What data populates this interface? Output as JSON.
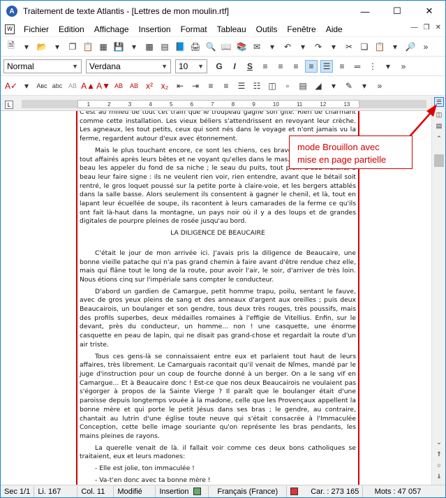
{
  "window": {
    "title": "Traitement de texte Atlantis - [Lettres de mon moulin.rtf]",
    "app_icon": "atlantis-logo-icon",
    "controls": [
      "minimize-icon",
      "maximize-icon",
      "close-icon"
    ]
  },
  "menu": {
    "items": [
      "Fichier",
      "Edition",
      "Affichage",
      "Insertion",
      "Format",
      "Tableau",
      "Outils",
      "Fenêtre",
      "Aide"
    ]
  },
  "format_toolbar": {
    "style_value": "Normal",
    "font_value": "Verdana",
    "size_value": "10"
  },
  "ruler": {
    "tab_selector": "L",
    "ticks": [
      "1",
      "2",
      "3",
      "4",
      "5",
      "6",
      "7",
      "8",
      "9",
      "10",
      "11",
      "12",
      "13"
    ]
  },
  "document": {
    "paragraphs": [
      "C'est au milieu de tout cet train que le troupeau gagne son gîte. Rien de charmant comme cette installation. Les vieux béliers s'attendrissent en revoyant leur crèche. Les agneaux, les tout petits, ceux qui sont nés dans le voyage et n'ont jamais vu la ferme, regardent autour d'eux avec étonnement.",
      "Mais le plus touchant encore, ce sont les chiens, ces braves chiens de berger, tout affairés après leurs bêtes et ne voyant qu'elles dans le mas. Le chien de garde a beau les appeler du fond de sa niche ; le seau du puits, tout plein d'eau fraîche, a beau leur faire signe : ils ne veulent rien voir, rien entendre, avant que le bétail soit rentré, le gros loquet poussé sur la petite porte à claire-voie, et les bergers attablés dans la salle basse. Alors seulement ils consentent à gagner le chenil, et là, tout en lapant leur écuellée de soupe, ils racontent à leurs camarades de la ferme ce qu'ils ont fait là-haut dans la montagne, un pays noir où il y a des loups et de grandes digitales de pourpre pleines de rosée jusqu'au bord."
    ],
    "heading": "LA DILIGENCE DE BEAUCAIRE",
    "paragraphs2": [
      "C'était le jour de mon arrivée ici. J'avais pris la diligence de Beaucaire, une bonne vieille patache qui n'a pas grand chemin à faire avant d'être rendue chez elle, mais qui flâne tout le long de la route, pour avoir l'air, le soir, d'arriver de très loin. Nous étions cinq sur l'impériale sans compter le conducteur.",
      "D'abord un gardien de Camargue, petit homme trapu, poilu, sentant le fauve, avec de gros yeux pleins de sang et des anneaux d'argent aux oreilles ; puis deux Beaucairois, un boulanger et son gendre, tous deux très rouges, très poussifs, mais des profils superbes, deux médailles romaines à l'effigie de Vitellius. Enfin, sur le devant, près du conducteur, un homme... non ! une casquette, une énorme casquette en peau de lapin, qui ne disait pas grand-chose et regardait la route d'un air triste.",
      "Tous ces gens-là se connaissaient entre eux et parlaient tout haut de leurs affaires, très librement. Le Camarguais racontait qu'il venait de Nîmes, mandé par le juge d'instruction pour un coup de fourche donné à un berger. On a le sang vif en Camargue... Et à Beaucaire donc ! Est-ce que nos deux Beaucairois ne voulaient pas s'égorger à propos de la Sainte Vierge ? Il paraît que le boulanger était d'une paroisse depuis longtemps vouée à la madone, celle que les Provençaux appellent la bonne mère et qui porte le petit Jésus dans ses bras ; le gendre, au contraire, chantait au lutrin d'une église toute neuve qui s'était consacrée à l'Immaculée Conception, cette belle image souriante qu'on représente les bras pendants, les mains pleines de rayons.",
      "La querelle venait de là. il fallait voir comme ces deux bons catholiques se traitaient, eux et leurs madones:",
      "- Elle est jolie, ton immaculée !",
      "- Va-t'en donc avec ta bonne mère !"
    ]
  },
  "annotation": {
    "text_line1": "mode Brouillon avec",
    "text_line2": "mise en page partielle",
    "color": "#d00000"
  },
  "status": {
    "section": "Sec 1/1",
    "line": "Li. 167",
    "col": "Col. 11",
    "modified": "Modifié",
    "mode": "Insertion",
    "language": "Français (France)",
    "chars": "Car. : 273 165",
    "words": "Mots : 47 057"
  }
}
